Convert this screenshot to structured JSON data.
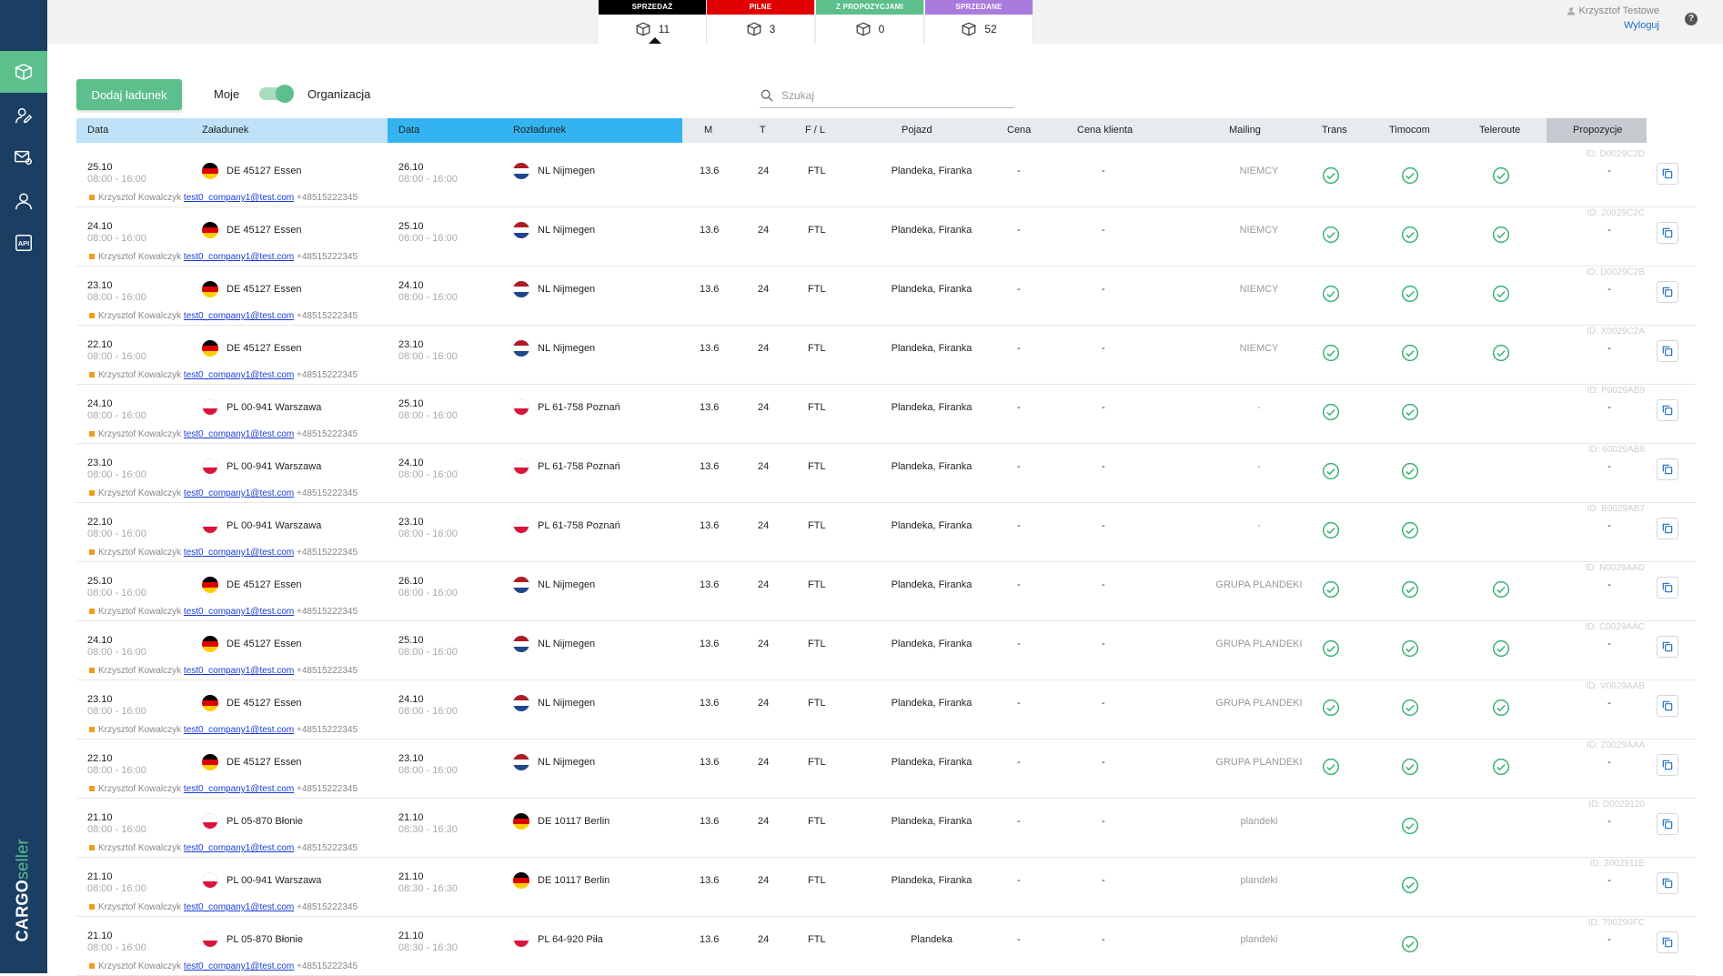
{
  "status_tabs": [
    {
      "label": "SPRZEDAŻ",
      "count": "11",
      "color": "#000000",
      "selected": true
    },
    {
      "label": "PILNE",
      "count": "3",
      "color": "#e10000",
      "selected": false
    },
    {
      "label": "Z PROPOZYCJAMI",
      "count": "0",
      "color": "#5cbf8c",
      "selected": false
    },
    {
      "label": "SPRZEDANE",
      "count": "52",
      "color": "#a97bdc",
      "selected": false
    }
  ],
  "user": {
    "name": "Krzysztof Testowe",
    "logout": "Wyloguj",
    "help": "?"
  },
  "sidebar": {
    "items": [
      {
        "icon": "package-icon",
        "active": true
      },
      {
        "icon": "user-edit-icon",
        "active": false
      },
      {
        "icon": "mail-settings-icon",
        "active": false
      },
      {
        "icon": "user-icon",
        "active": false
      },
      {
        "icon": "api-icon",
        "active": false
      }
    ],
    "brand_main": "CARGO",
    "brand_sub": "seller"
  },
  "toolbar": {
    "add_button": "Dodaj ładunek",
    "toggle_left": "Moje",
    "toggle_right": "Organizacja",
    "search_placeholder": "Szukaj"
  },
  "columns": {
    "load_date": "Data",
    "load_place": "Załadunek",
    "unload_date": "Data",
    "unload_place": "Rozładunek",
    "m": "M",
    "t": "T",
    "fl": "F / L",
    "vehicle": "Pojazd",
    "price": "Cena",
    "client_price": "Cena klienta",
    "mailing": "Mailing",
    "trans": "Trans",
    "timocom": "Timocom",
    "teleroute": "Teleroute",
    "proposals": "Propozycje"
  },
  "colors": {
    "accent": "#5cbf8c",
    "sidebar": "#1b3e63",
    "check": "#3bb273"
  },
  "rows": [
    {
      "load_date": "25.10",
      "load_time": "08:00 - 16:00",
      "load_flag": "de",
      "load_place": "DE 45127 Essen",
      "unload_date": "26.10",
      "unload_time": "08:00 - 16:00",
      "unload_flag": "nl",
      "unload_place": "NL Nijmegen",
      "m": "13.6",
      "t": "24",
      "fl": "FTL",
      "vehicle": "Plandeka, Firanka",
      "price": "-",
      "client_price": "-",
      "mailing": "NIEMCY",
      "trans": true,
      "timocom": true,
      "teleroute": true,
      "id": "ID: D0029C2D",
      "proposals": "-",
      "contact_name": "Krzysztof Kowalczyk",
      "contact_email": "test0_company1@test.com",
      "contact_phone": "+48515222345"
    },
    {
      "load_date": "24.10",
      "load_time": "08:00 - 16:00",
      "load_flag": "de",
      "load_place": "DE 45127 Essen",
      "unload_date": "25.10",
      "unload_time": "08:00 - 16:00",
      "unload_flag": "nl",
      "unload_place": "NL Nijmegen",
      "m": "13.6",
      "t": "24",
      "fl": "FTL",
      "vehicle": "Plandeka, Firanka",
      "price": "-",
      "client_price": "-",
      "mailing": "NIEMCY",
      "trans": true,
      "timocom": true,
      "teleroute": true,
      "id": "ID: 20029C2C",
      "proposals": "-",
      "contact_name": "Krzysztof Kowalczyk",
      "contact_email": "test0_company1@test.com",
      "contact_phone": "+48515222345"
    },
    {
      "load_date": "23.10",
      "load_time": "08:00 - 16:00",
      "load_flag": "de",
      "load_place": "DE 45127 Essen",
      "unload_date": "24.10",
      "unload_time": "08:00 - 16:00",
      "unload_flag": "nl",
      "unload_place": "NL Nijmegen",
      "m": "13.6",
      "t": "24",
      "fl": "FTL",
      "vehicle": "Plandeka, Firanka",
      "price": "-",
      "client_price": "-",
      "mailing": "NIEMCY",
      "trans": true,
      "timocom": true,
      "teleroute": true,
      "id": "ID: D0029C2B",
      "proposals": "-",
      "contact_name": "Krzysztof Kowalczyk",
      "contact_email": "test0_company1@test.com",
      "contact_phone": "+48515222345"
    },
    {
      "load_date": "22.10",
      "load_time": "08:00 - 16:00",
      "load_flag": "de",
      "load_place": "DE 45127 Essen",
      "unload_date": "23.10",
      "unload_time": "08:00 - 16:00",
      "unload_flag": "nl",
      "unload_place": "NL Nijmegen",
      "m": "13.6",
      "t": "24",
      "fl": "FTL",
      "vehicle": "Plandeka, Firanka",
      "price": "-",
      "client_price": "-",
      "mailing": "NIEMCY",
      "trans": true,
      "timocom": true,
      "teleroute": true,
      "id": "ID: X0029C2A",
      "proposals": "-",
      "contact_name": "Krzysztof Kowalczyk",
      "contact_email": "test0_company1@test.com",
      "contact_phone": "+48515222345"
    },
    {
      "load_date": "24.10",
      "load_time": "08:00 - 16:00",
      "load_flag": "pl",
      "load_place": "PL 00-941 Warszawa",
      "unload_date": "25.10",
      "unload_time": "08:00 - 16:00",
      "unload_flag": "pl",
      "unload_place": "PL 61-758 Poznań",
      "m": "13.6",
      "t": "24",
      "fl": "FTL",
      "vehicle": "Plandeka, Firanka",
      "price": "-",
      "client_price": "-",
      "mailing": "-",
      "trans": true,
      "timocom": true,
      "teleroute": false,
      "id": "ID: P0029AB9",
      "proposals": "-",
      "contact_name": "Krzysztof Kowalczyk",
      "contact_email": "test0_company1@test.com",
      "contact_phone": "+48515222345"
    },
    {
      "load_date": "23.10",
      "load_time": "08:00 - 16:00",
      "load_flag": "pl",
      "load_place": "PL 00-941 Warszawa",
      "unload_date": "24.10",
      "unload_time": "08:00 - 16:00",
      "unload_flag": "pl",
      "unload_place": "PL 61-758 Poznań",
      "m": "13.6",
      "t": "24",
      "fl": "FTL",
      "vehicle": "Plandeka, Firanka",
      "price": "-",
      "client_price": "-",
      "mailing": "-",
      "trans": true,
      "timocom": true,
      "teleroute": false,
      "id": "ID: 60029AB8",
      "proposals": "-",
      "contact_name": "Krzysztof Kowalczyk",
      "contact_email": "test0_company1@test.com",
      "contact_phone": "+48515222345"
    },
    {
      "load_date": "22.10",
      "load_time": "08:00 - 16:00",
      "load_flag": "pl",
      "load_place": "PL 00-941 Warszawa",
      "unload_date": "23.10",
      "unload_time": "08:00 - 16:00",
      "unload_flag": "pl",
      "unload_place": "PL 61-758 Poznań",
      "m": "13.6",
      "t": "24",
      "fl": "FTL",
      "vehicle": "Plandeka, Firanka",
      "price": "-",
      "client_price": "-",
      "mailing": "-",
      "trans": true,
      "timocom": true,
      "teleroute": false,
      "id": "ID: B0029AB7",
      "proposals": "-",
      "contact_name": "Krzysztof Kowalczyk",
      "contact_email": "test0_company1@test.com",
      "contact_phone": "+48515222345"
    },
    {
      "load_date": "25.10",
      "load_time": "08:00 - 16:00",
      "load_flag": "de",
      "load_place": "DE 45127 Essen",
      "unload_date": "26.10",
      "unload_time": "08:00 - 16:00",
      "unload_flag": "nl",
      "unload_place": "NL Nijmegen",
      "m": "13.6",
      "t": "24",
      "fl": "FTL",
      "vehicle": "Plandeka, Firanka",
      "price": "-",
      "client_price": "-",
      "mailing": "GRUPA PLANDEKI",
      "trans": true,
      "timocom": true,
      "teleroute": true,
      "id": "ID: N0029AAD",
      "proposals": "-",
      "contact_name": "Krzysztof Kowalczyk",
      "contact_email": "test0_company1@test.com",
      "contact_phone": "+48515222345"
    },
    {
      "load_date": "24.10",
      "load_time": "08:00 - 16:00",
      "load_flag": "de",
      "load_place": "DE 45127 Essen",
      "unload_date": "25.10",
      "unload_time": "08:00 - 16:00",
      "unload_flag": "nl",
      "unload_place": "NL Nijmegen",
      "m": "13.6",
      "t": "24",
      "fl": "FTL",
      "vehicle": "Plandeka, Firanka",
      "price": "-",
      "client_price": "-",
      "mailing": "GRUPA PLANDEKI",
      "trans": true,
      "timocom": true,
      "teleroute": true,
      "id": "ID: C0029AAC",
      "proposals": "-",
      "contact_name": "Krzysztof Kowalczyk",
      "contact_email": "test0_company1@test.com",
      "contact_phone": "+48515222345"
    },
    {
      "load_date": "23.10",
      "load_time": "08:00 - 16:00",
      "load_flag": "de",
      "load_place": "DE 45127 Essen",
      "unload_date": "24.10",
      "unload_time": "08:00 - 16:00",
      "unload_flag": "nl",
      "unload_place": "NL Nijmegen",
      "m": "13.6",
      "t": "24",
      "fl": "FTL",
      "vehicle": "Plandeka, Firanka",
      "price": "-",
      "client_price": "-",
      "mailing": "GRUPA PLANDEKI",
      "trans": true,
      "timocom": true,
      "teleroute": true,
      "id": "ID: V0029AAB",
      "proposals": "-",
      "contact_name": "Krzysztof Kowalczyk",
      "contact_email": "test0_company1@test.com",
      "contact_phone": "+48515222345"
    },
    {
      "load_date": "22.10",
      "load_time": "08:00 - 16:00",
      "load_flag": "de",
      "load_place": "DE 45127 Essen",
      "unload_date": "23.10",
      "unload_time": "08:00 - 16:00",
      "unload_flag": "nl",
      "unload_place": "NL Nijmegen",
      "m": "13.6",
      "t": "24",
      "fl": "FTL",
      "vehicle": "Plandeka, Firanka",
      "price": "-",
      "client_price": "-",
      "mailing": "GRUPA PLANDEKI",
      "trans": true,
      "timocom": true,
      "teleroute": true,
      "id": "ID: Z0029AAA",
      "proposals": "-",
      "contact_name": "Krzysztof Kowalczyk",
      "contact_email": "test0_company1@test.com",
      "contact_phone": "+48515222345"
    },
    {
      "load_date": "21.10",
      "load_time": "08:00 - 16:00",
      "load_flag": "pl",
      "load_place": "PL 05-870 Błonie",
      "unload_date": "21.10",
      "unload_time": "08:30 - 16:30",
      "unload_flag": "de",
      "unload_place": "DE 10117 Berlin",
      "m": "13.6",
      "t": "24",
      "fl": "FTL",
      "vehicle": "Plandeka, Firanka",
      "price": "-",
      "client_price": "-",
      "mailing": "plandeki",
      "trans": false,
      "timocom": true,
      "teleroute": false,
      "id": "ID: D0029120",
      "proposals": "-",
      "contact_name": "Krzysztof Kowalczyk",
      "contact_email": "test0_company1@test.com",
      "contact_phone": "+48515222345"
    },
    {
      "load_date": "21.10",
      "load_time": "08:00 - 16:00",
      "load_flag": "pl",
      "load_place": "PL 00-941 Warszawa",
      "unload_date": "21.10",
      "unload_time": "08:30 - 16:30",
      "unload_flag": "de",
      "unload_place": "DE 10117 Berlin",
      "m": "13.6",
      "t": "24",
      "fl": "FTL",
      "vehicle": "Plandeka, Firanka",
      "price": "-",
      "client_price": "-",
      "mailing": "plandeki",
      "trans": false,
      "timocom": true,
      "teleroute": false,
      "id": "ID: 2002911E",
      "proposals": "-",
      "contact_name": "Krzysztof Kowalczyk",
      "contact_email": "test0_company1@test.com",
      "contact_phone": "+48515222345"
    },
    {
      "load_date": "21.10",
      "load_time": "08:00 - 16:00",
      "load_flag": "pl",
      "load_place": "PL 05-870 Błonie",
      "unload_date": "21.10",
      "unload_time": "08:30 - 16:30",
      "unload_flag": "pl",
      "unload_place": "PL 64-920 Piła",
      "m": "13.6",
      "t": "24",
      "fl": "FTL",
      "vehicle": "Plandeka",
      "price": "-",
      "client_price": "-",
      "mailing": "plandeki",
      "trans": false,
      "timocom": true,
      "teleroute": false,
      "id": "ID: 700290FC",
      "proposals": "-",
      "contact_name": "Krzysztof Kowalczyk",
      "contact_email": "test0_company1@test.com",
      "contact_phone": "+48515222345"
    }
  ]
}
